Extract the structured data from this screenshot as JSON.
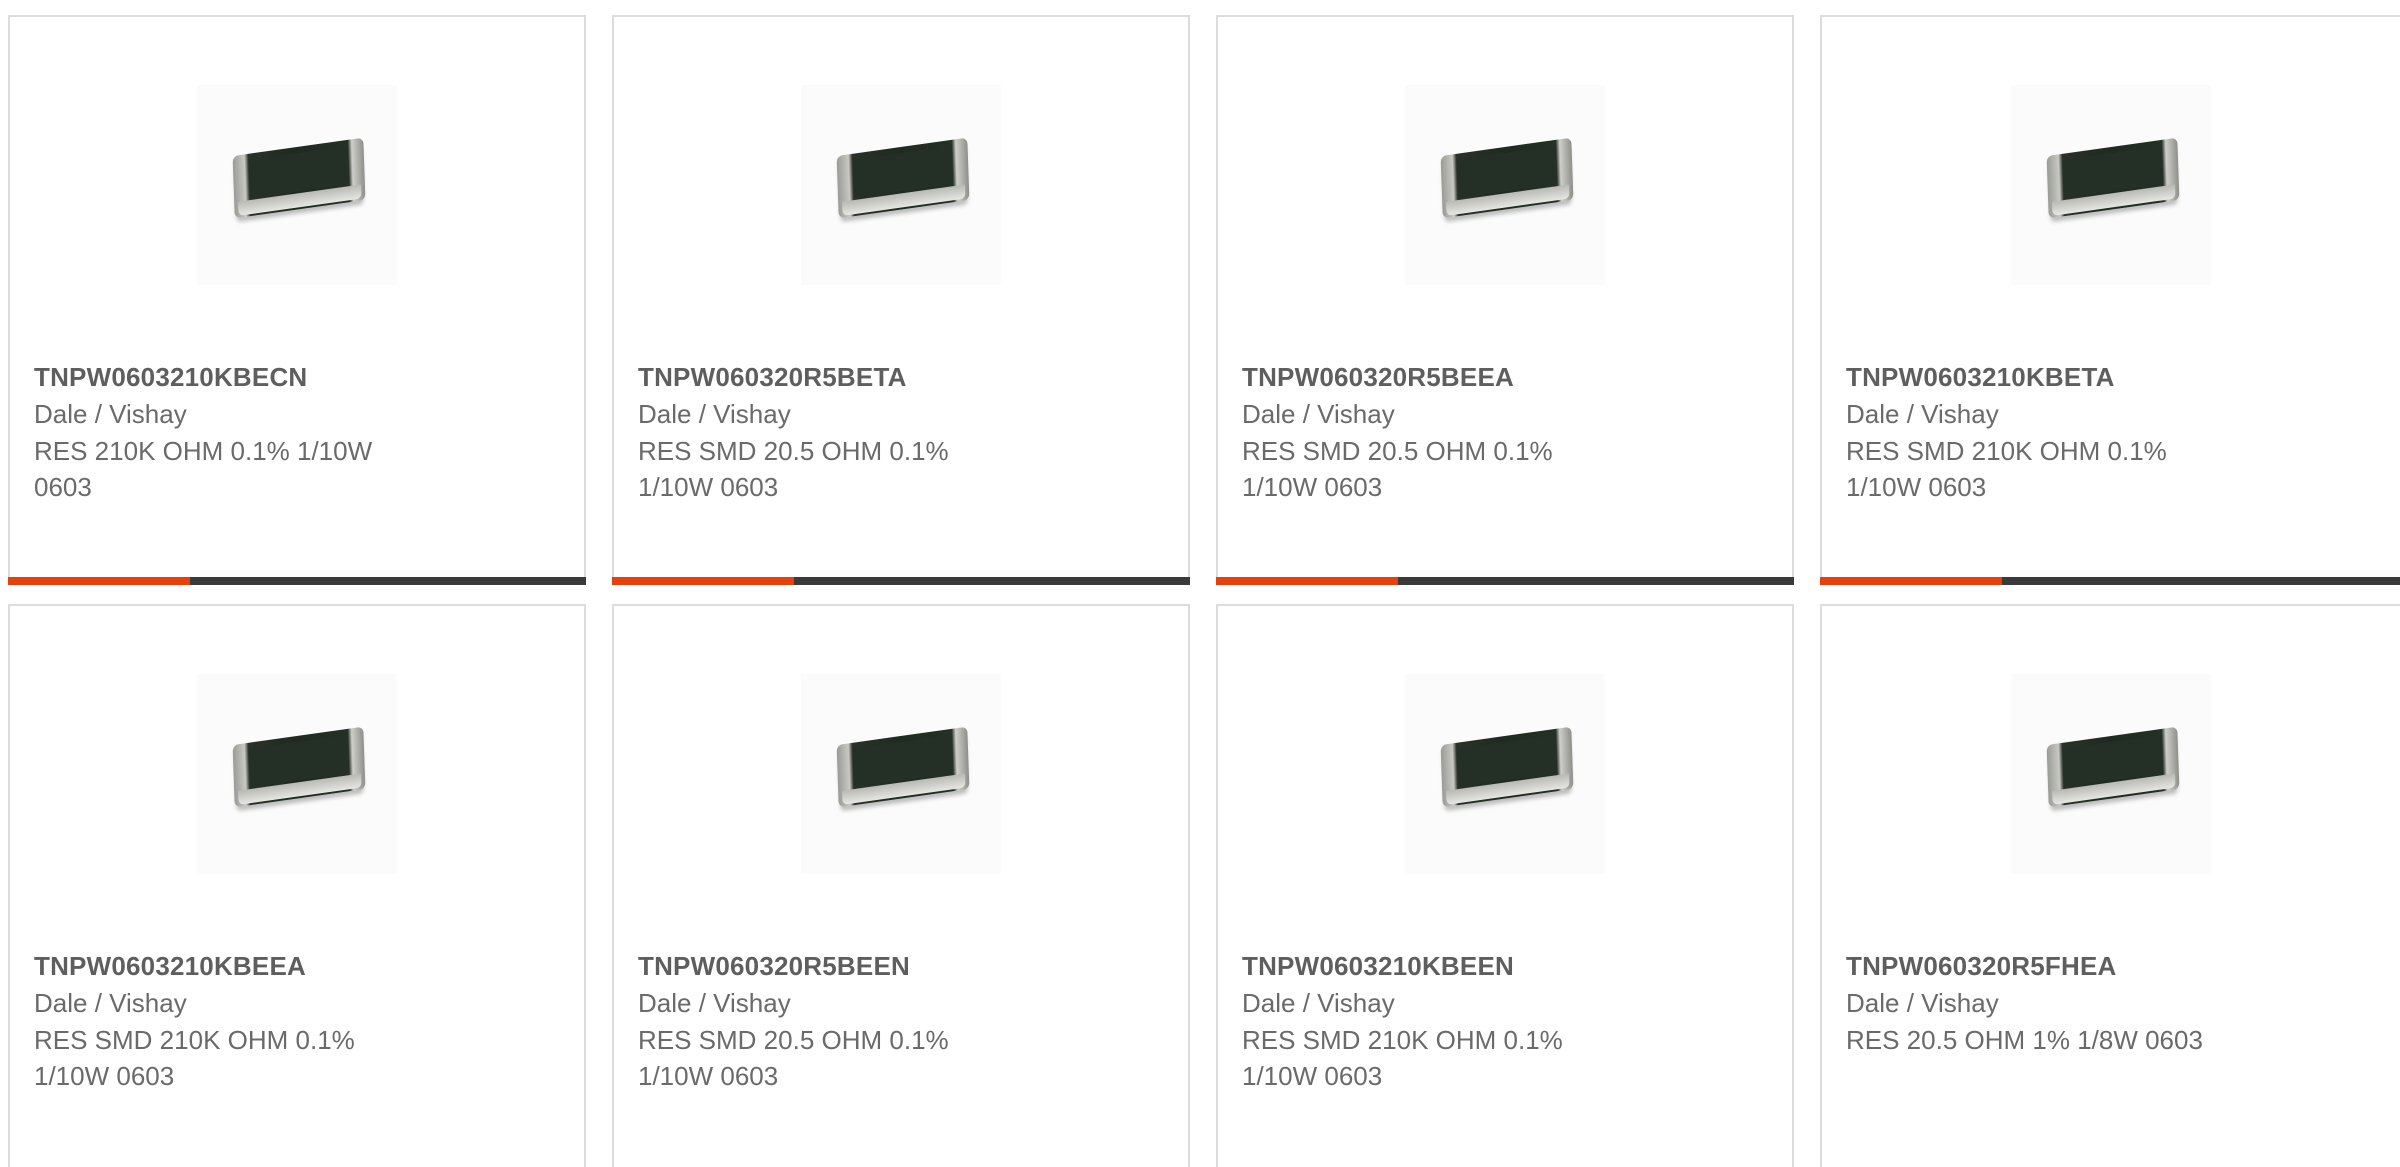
{
  "products": [
    {
      "part_number": "TNPW0603210KBECN",
      "manufacturer": "Dale / Vishay",
      "description": "RES 210K OHM 0.1% 1/10W 0603"
    },
    {
      "part_number": "TNPW060320R5BETA",
      "manufacturer": "Dale / Vishay",
      "description": "RES SMD 20.5 OHM 0.1% 1/10W 0603"
    },
    {
      "part_number": "TNPW060320R5BEEA",
      "manufacturer": "Dale / Vishay",
      "description": "RES SMD 20.5 OHM 0.1% 1/10W 0603"
    },
    {
      "part_number": "TNPW0603210KBETA",
      "manufacturer": "Dale / Vishay",
      "description": "RES SMD 210K OHM 0.1% 1/10W 0603"
    },
    {
      "part_number": "TNPW0603210KBEEA",
      "manufacturer": "Dale / Vishay",
      "description": "RES SMD 210K OHM 0.1% 1/10W 0603"
    },
    {
      "part_number": "TNPW060320R5BEEN",
      "manufacturer": "Dale / Vishay",
      "description": "RES SMD 20.5 OHM 0.1% 1/10W 0603"
    },
    {
      "part_number": "TNPW0603210KBEEN",
      "manufacturer": "Dale / Vishay",
      "description": "RES SMD 210K OHM 0.1% 1/10W 0603"
    },
    {
      "part_number": "TNPW060320R5FHEA",
      "manufacturer": "Dale / Vishay",
      "description": "RES 20.5 OHM 1% 1/8W 0603"
    }
  ],
  "colors": {
    "accent": "#e8400c",
    "bar_dark": "#3a3a3a",
    "border": "#dcdcdc",
    "text": "#666666"
  },
  "icons": {
    "product_image": "smd-resistor-chip-icon"
  }
}
